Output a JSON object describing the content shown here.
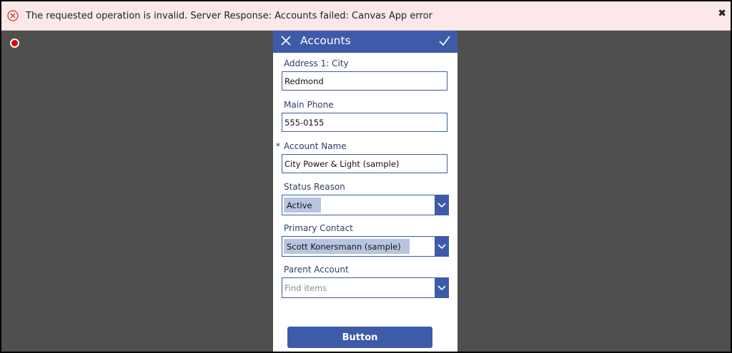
{
  "error": {
    "message": "The requested operation is invalid. Server Response: Accounts failed: Canvas App error",
    "close_glyph": "✖",
    "icon": "error-circle-x-icon",
    "color": "#d13438"
  },
  "form": {
    "title": "Accounts",
    "header_color": "#3d5ba9",
    "fields": {
      "city": {
        "label": "Address 1: City",
        "value": "Redmond"
      },
      "phone": {
        "label": "Main Phone",
        "value": "555-0155"
      },
      "account_name": {
        "label": "Account Name",
        "value": "City Power & Light (sample)",
        "required_marker": "*"
      },
      "status_reason": {
        "label": "Status Reason",
        "value": "Active"
      },
      "primary_contact": {
        "label": "Primary Contact",
        "value": "Scott Konersmann (sample)"
      },
      "parent_account": {
        "label": "Parent Account",
        "placeholder": "Find items"
      }
    },
    "button_label": "Button"
  }
}
